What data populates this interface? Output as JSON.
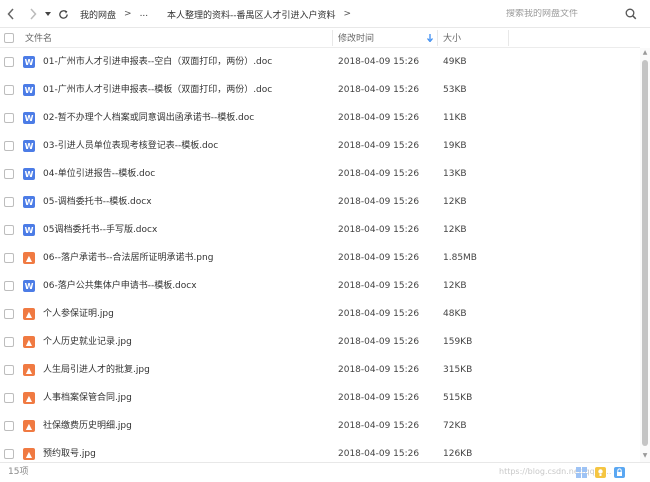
{
  "toolbar": {
    "breadcrumb": [
      {
        "label": "我的网盘"
      },
      {
        "label": "..."
      },
      {
        "label": "本人整理的资料--番禺区人才引进入户资料"
      }
    ],
    "search_placeholder": "搜索我的网盘文件"
  },
  "header": {
    "name": "文件名",
    "modified": "修改时间",
    "size": "大小"
  },
  "files": [
    {
      "icon": "word-doc-icon",
      "type": "doc",
      "glyph": "W",
      "name": "01-广州市人才引进申报表--空白（双面打印，两份）.doc",
      "time": "2018-04-09 15:26",
      "size": "49KB"
    },
    {
      "icon": "word-doc-icon",
      "type": "doc",
      "glyph": "W",
      "name": "01-广州市人才引进申报表--模板（双面打印，两份）.doc",
      "time": "2018-04-09 15:26",
      "size": "53KB"
    },
    {
      "icon": "word-doc-icon",
      "type": "doc",
      "glyph": "W",
      "name": "02-暂不办理个人档案或同意调出函承诺书--模板.doc",
      "time": "2018-04-09 15:26",
      "size": "11KB"
    },
    {
      "icon": "word-doc-icon",
      "type": "doc",
      "glyph": "W",
      "name": "03-引进人员单位表现考核登记表--模板.doc",
      "time": "2018-04-09 15:26",
      "size": "19KB"
    },
    {
      "icon": "word-doc-icon",
      "type": "doc",
      "glyph": "W",
      "name": "04-单位引进报告--模板.doc",
      "time": "2018-04-09 15:26",
      "size": "13KB"
    },
    {
      "icon": "word-doc-icon",
      "type": "doc",
      "glyph": "W",
      "name": "05-调档委托书--模板.docx",
      "time": "2018-04-09 15:26",
      "size": "12KB"
    },
    {
      "icon": "word-doc-icon",
      "type": "doc",
      "glyph": "W",
      "name": "05调档委托书--手写版.docx",
      "time": "2018-04-09 15:26",
      "size": "12KB"
    },
    {
      "icon": "image-file-icon",
      "type": "img",
      "glyph": "▲",
      "name": "06--落户承诺书--合法居所证明承诺书.png",
      "time": "2018-04-09 15:26",
      "size": "1.85MB"
    },
    {
      "icon": "word-doc-icon",
      "type": "doc",
      "glyph": "W",
      "name": "06-落户公共集体户申请书--模板.docx",
      "time": "2018-04-09 15:26",
      "size": "12KB"
    },
    {
      "icon": "image-file-icon",
      "type": "img",
      "glyph": "▲",
      "name": "个人参保证明.jpg",
      "time": "2018-04-09 15:26",
      "size": "48KB"
    },
    {
      "icon": "image-file-icon",
      "type": "img",
      "glyph": "▲",
      "name": "个人历史就业记录.jpg",
      "time": "2018-04-09 15:26",
      "size": "159KB"
    },
    {
      "icon": "image-file-icon",
      "type": "img",
      "glyph": "▲",
      "name": "人生局引进人才的批复.jpg",
      "time": "2018-04-09 15:26",
      "size": "315KB"
    },
    {
      "icon": "image-file-icon",
      "type": "img",
      "glyph": "▲",
      "name": "人事档案保管合同.jpg",
      "time": "2018-04-09 15:26",
      "size": "515KB"
    },
    {
      "icon": "image-file-icon",
      "type": "img",
      "glyph": "▲",
      "name": "社保缴费历史明细.jpg",
      "time": "2018-04-09 15:26",
      "size": "72KB"
    },
    {
      "icon": "image-file-icon",
      "type": "img",
      "glyph": "▲",
      "name": "预约取号.jpg",
      "time": "2018-04-09 15:26",
      "size": "126KB"
    }
  ],
  "footer": {
    "count": "15项",
    "watermark": "https://blog.csdn.net/qq_4..."
  },
  "colors": {
    "doc_icon": "#4c7ce6",
    "image_icon": "#f07a42",
    "sort_arrow": "#3b8cf0"
  }
}
